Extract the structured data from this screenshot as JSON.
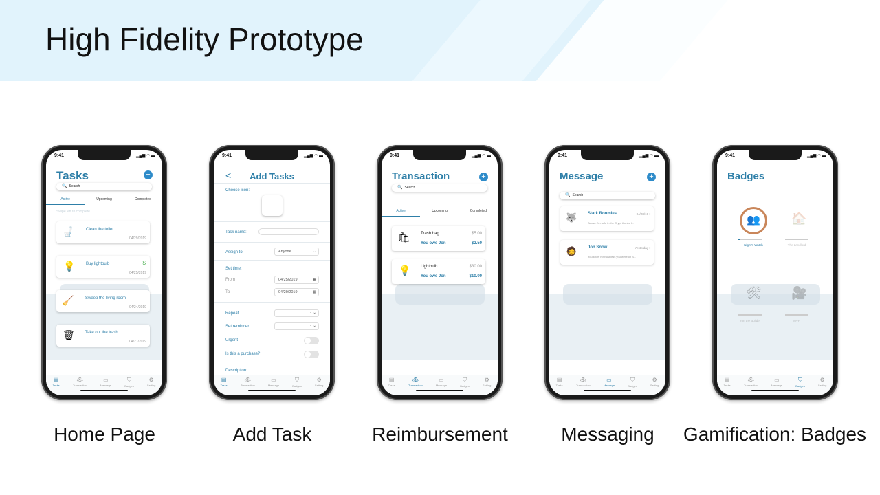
{
  "slide_title": "High Fidelity Prototype",
  "captions": [
    "Home Page",
    "Add Task",
    "Reimbursement",
    "Messaging",
    "Gamification: Badges"
  ],
  "status_time": "9:41",
  "nav_labels": [
    "Tasks",
    "Transaction",
    "Message",
    "Badges",
    "Setting"
  ],
  "home": {
    "title": "Tasks",
    "search": "Search",
    "tabs": [
      "Active",
      "Upcoming",
      "Completed"
    ],
    "hint": "Swipe left to complete",
    "tasks": [
      {
        "name": "Clean the toilet",
        "date": "04/29/2019",
        "icon": "🚽"
      },
      {
        "name": "Buy lightbulb",
        "date": "04/25/2019",
        "icon": "💡",
        "badge": "$"
      },
      {
        "name": "Sweep the living room",
        "date": "04/24/2019",
        "icon": "🧹"
      },
      {
        "name": "Take out the trash",
        "date": "04/21/2019",
        "icon": "🗑"
      }
    ]
  },
  "add": {
    "title": "Add Tasks",
    "back": "<",
    "choose_icon": "Choose icon:",
    "task_name": "Task name:",
    "assign_to": "Assign to:",
    "assign_value": "Anyone",
    "set_time": "Set time:",
    "from": "From",
    "from_date": "04/25/2019",
    "to": "To",
    "to_date": "04/29/2019",
    "repeat": "Repeat",
    "repeat_value": "-",
    "reminder": "Set reminder",
    "reminder_value": "-",
    "urgent": "Urgent",
    "purchase": "Is this a purchase?",
    "description": "Description:"
  },
  "transaction": {
    "title": "Transaction",
    "search": "Search",
    "tabs": [
      "Active",
      "Upcoming",
      "Completed"
    ],
    "items": [
      {
        "name": "Trash bag",
        "price": "$5.00",
        "owe": "You owe Jon",
        "amount": "$2.50",
        "icon": "🛍"
      },
      {
        "name": "Lightbulb",
        "price": "$30.00",
        "owe": "You owe Jon",
        "amount": "$10.00",
        "icon": "💡"
      }
    ]
  },
  "message": {
    "title": "Message",
    "search": "Search",
    "threads": [
      {
        "name": "Stark Roomies",
        "time": "04/28/19 >",
        "preview": "Bansu: i'm safe in the Crypt thanks I...",
        "icon": "🐺"
      },
      {
        "name": "Jon Snow",
        "time": "Yesterday >",
        "preview": "You know how useless you were on S...",
        "icon": "🧔"
      }
    ]
  },
  "badges": {
    "title": "Badges",
    "items": [
      {
        "name": "Night's Watch",
        "icon": "👥",
        "progress": 0.05
      },
      {
        "name": "The Landlord",
        "icon": "🏠",
        "progress": 0
      },
      {
        "name": "Iron the Builder",
        "icon": "🛠",
        "progress": 0
      },
      {
        "name": "MVP",
        "icon": "🎥",
        "progress": 0
      }
    ]
  }
}
